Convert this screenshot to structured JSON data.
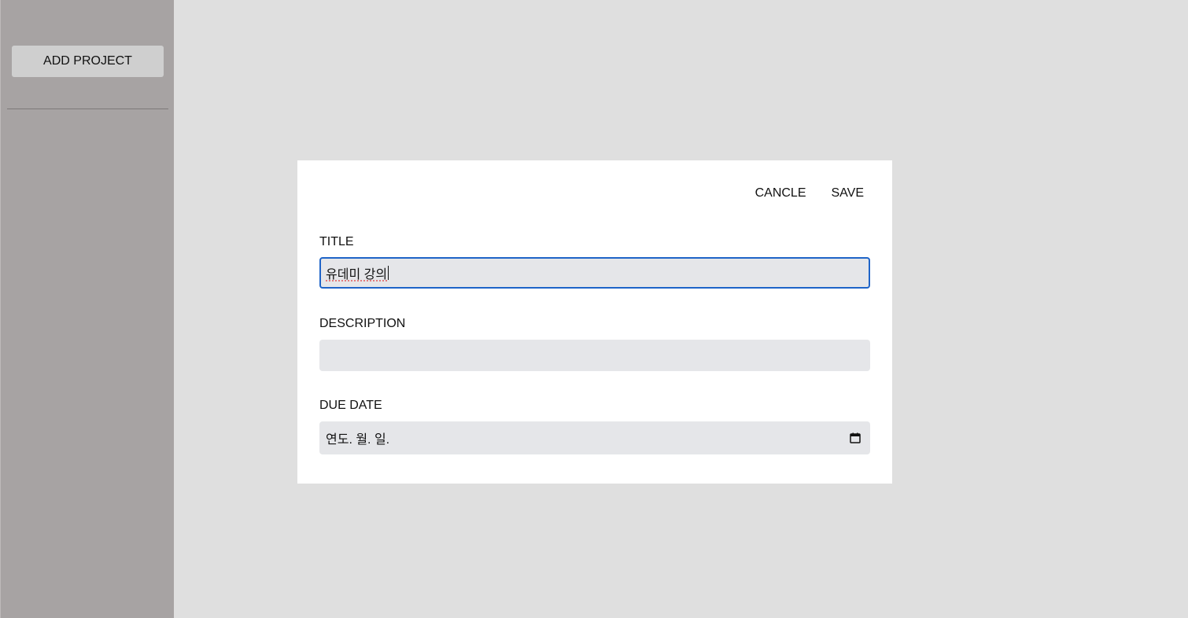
{
  "sidebar": {
    "add_project_label": "ADD PROJECT"
  },
  "modal": {
    "cancel_label": "CANCLE",
    "save_label": "SAVE",
    "fields": {
      "title": {
        "label": "TITLE",
        "value": "유데미 강의"
      },
      "description": {
        "label": "DESCRIPTION",
        "value": ""
      },
      "due_date": {
        "label": "DUE DATE",
        "value": "연도. 월. 일.",
        "icon": "calendar-icon"
      }
    }
  },
  "colors": {
    "background": "#dfdfdf",
    "sidebar": "#a7a3a3",
    "modal": "#ffffff",
    "input": "#e5e6e9",
    "focus": "#1f64c8"
  }
}
